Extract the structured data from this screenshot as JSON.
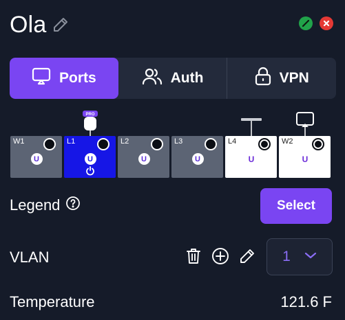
{
  "header": {
    "title": "Ola"
  },
  "tabs": [
    {
      "label": "Ports",
      "icon": "cast-icon",
      "active": true
    },
    {
      "label": "Auth",
      "icon": "users-icon",
      "active": false
    },
    {
      "label": "VPN",
      "icon": "lock-icon",
      "active": false
    }
  ],
  "ports": [
    {
      "label": "W1",
      "badge": "U",
      "style": "gray"
    },
    {
      "label": "L1",
      "badge": "U",
      "style": "blue",
      "power": true,
      "device_badge": "PRO"
    },
    {
      "label": "L2",
      "badge": "U",
      "style": "gray"
    },
    {
      "label": "L3",
      "badge": "U",
      "style": "gray"
    },
    {
      "label": "L4",
      "badge": "U",
      "style": "white"
    },
    {
      "label": "W2",
      "badge": "U",
      "style": "white"
    }
  ],
  "legend": {
    "label": "Legend",
    "select_label": "Select"
  },
  "vlan": {
    "label": "VLAN",
    "value": "1"
  },
  "temperature": {
    "label": "Temperature",
    "value": "121.6 F"
  },
  "colors": {
    "accent": "#7a45f2",
    "background": "#151b29",
    "ok": "#21a34a",
    "error": "#e53935"
  }
}
